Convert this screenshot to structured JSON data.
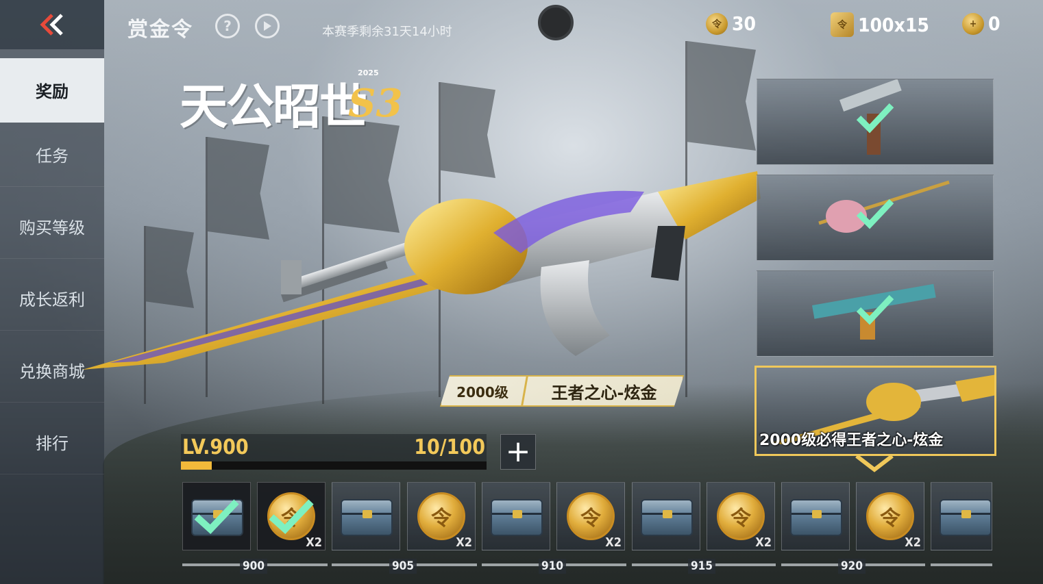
{
  "header": {
    "title": "赏金令",
    "help_icon": "question-circle-icon",
    "play_icon": "play-circle-icon",
    "season_remaining": "本赛季剩余31天14小时"
  },
  "currencies": [
    {
      "icon": "bounty-coin-icon",
      "value": "30"
    },
    {
      "icon": "token-box-icon",
      "value": "100x15"
    },
    {
      "icon": "ticket-coin-icon",
      "value": "0"
    }
  ],
  "sidebar": {
    "items": [
      {
        "label": "奖励",
        "active": true
      },
      {
        "label": "任务",
        "active": false
      },
      {
        "label": "购买等级",
        "active": false
      },
      {
        "label": "成长返利",
        "active": false
      },
      {
        "label": "兑换商城",
        "active": false
      },
      {
        "label": "排行",
        "active": false
      }
    ]
  },
  "season_logo": {
    "title": "天公昭世",
    "year": "2025",
    "season": "S3"
  },
  "featured": {
    "level": "2000级",
    "name": "王者之心-炫金"
  },
  "previews": [
    {
      "claimed": true
    },
    {
      "claimed": true
    },
    {
      "claimed": true
    },
    {
      "claimed": false,
      "label": "2000级必得王者之心-炫金"
    }
  ],
  "level": {
    "label": "LV.900",
    "progress_text": "10/100",
    "progress_fraction": 0.1,
    "add_label": "+"
  },
  "rewards": [
    {
      "type": "chest",
      "claimed": true,
      "mult": ""
    },
    {
      "type": "coin",
      "claimed": true,
      "mult": "X2"
    },
    {
      "type": "chest",
      "claimed": false,
      "mult": ""
    },
    {
      "type": "coin",
      "claimed": false,
      "mult": "X2"
    },
    {
      "type": "chest",
      "claimed": false,
      "mult": ""
    },
    {
      "type": "coin",
      "claimed": false,
      "mult": "X2"
    },
    {
      "type": "chest",
      "claimed": false,
      "mult": ""
    },
    {
      "type": "coin",
      "claimed": false,
      "mult": "X2"
    },
    {
      "type": "chest",
      "claimed": false,
      "mult": ""
    },
    {
      "type": "coin",
      "claimed": false,
      "mult": "X2"
    },
    {
      "type": "chest",
      "claimed": false,
      "mult": ""
    }
  ],
  "level_markers": [
    "900",
    "905",
    "910",
    "915",
    "920"
  ],
  "colors": {
    "accent_gold": "#f3c95a",
    "active_tab_bg": "#e8ecef",
    "check_green": "#7ef0c0"
  }
}
